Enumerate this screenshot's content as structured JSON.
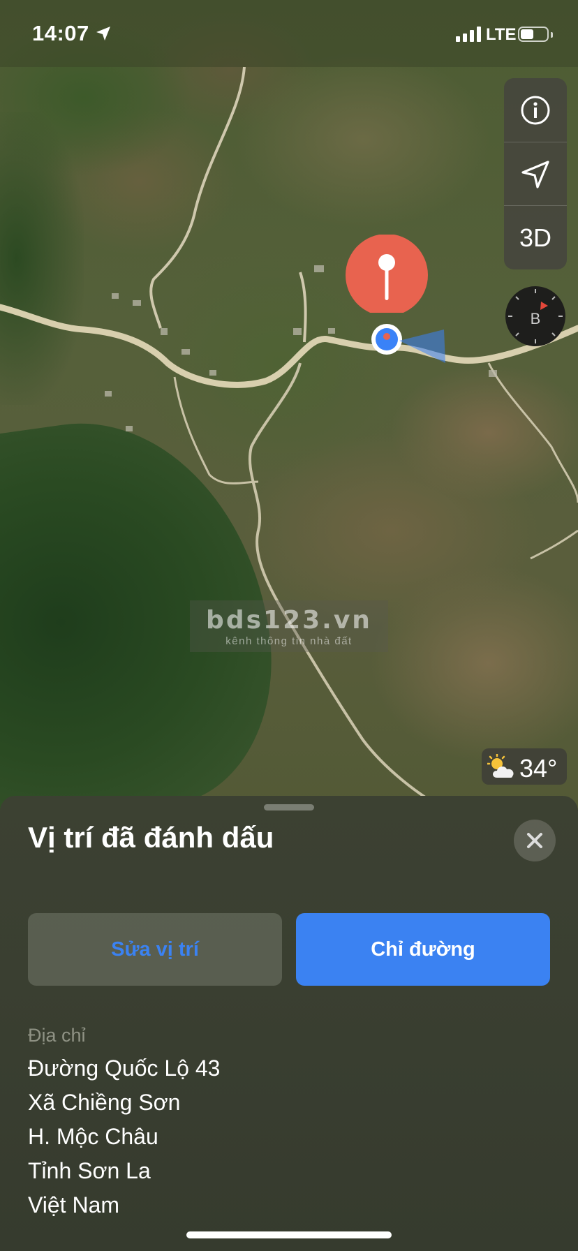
{
  "status_bar": {
    "time": "14:07",
    "network": "LTE",
    "battery_level": 0.5
  },
  "map": {
    "controls": {
      "info_icon": "info-circle-icon",
      "locate_icon": "location-arrow-icon",
      "view_mode_label": "3D"
    },
    "compass": {
      "letter": "B"
    },
    "watermark": {
      "main": "bds123.vn",
      "sub": "kênh thông tin nhà đất"
    },
    "weather": {
      "icon": "partly-cloudy-sun-icon",
      "temperature": "34°"
    },
    "pin_color": "#e8634f",
    "user_location_color": "#3a82f7"
  },
  "sheet": {
    "title": "Vị trí đã đánh dấu",
    "buttons": {
      "edit_label": "Sửa vị trí",
      "directions_label": "Chỉ đường"
    },
    "address": {
      "label": "Địa chỉ",
      "lines": [
        "Đường Quốc Lộ 43",
        "Xã Chiềng Sơn",
        "H. Mộc Châu",
        "Tỉnh Sơn La",
        "Việt Nam"
      ]
    },
    "accent_color": "#3b82f2"
  }
}
